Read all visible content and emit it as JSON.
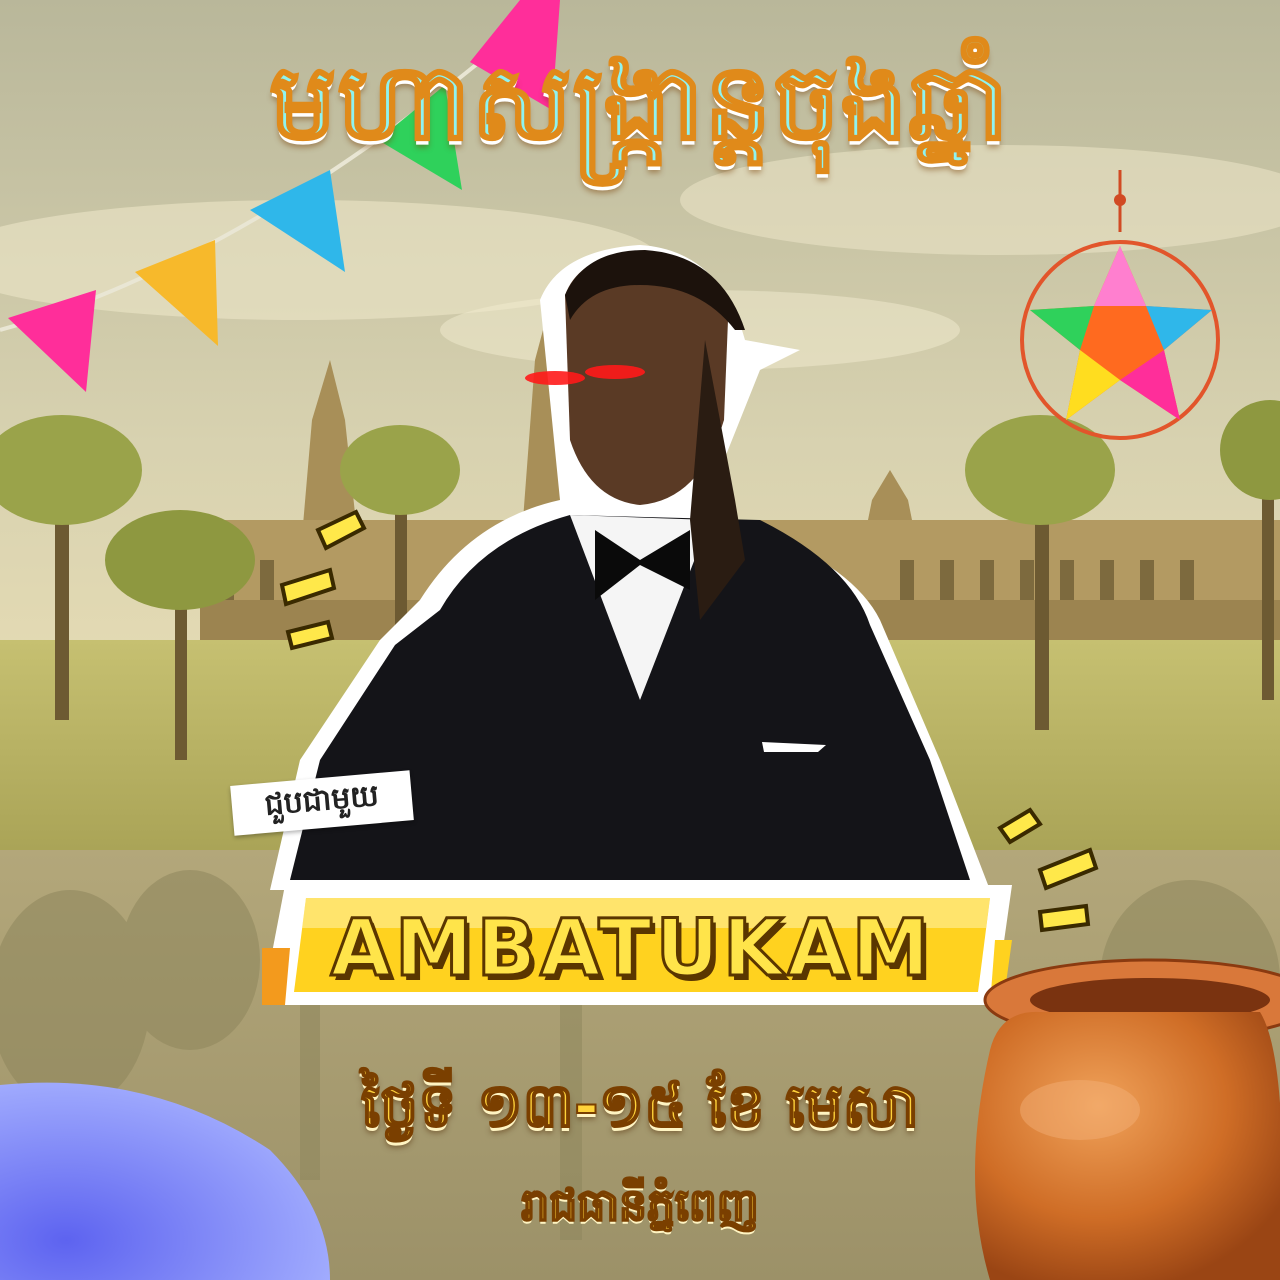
{
  "poster": {
    "title": "មហាសង្រ្កាន្តចុងឆ្នាំ",
    "tagline": "ជួបជាមួយ",
    "performer_name": "AMBATUKAM",
    "date_line": "ថ្ងៃទី ១៣-១៥ ខែ មេសា",
    "venue": "រាជធានីភ្នំពេញ"
  },
  "colors": {
    "sky_top": "#c9c7a8",
    "grass": "#b9b764",
    "water": "#a89e72",
    "title_fill": "#8ff3ef",
    "title_outline": "#e08a1a",
    "banner_yellow": "#ffd21f",
    "accent_pink": "#ff2e9a",
    "accent_blue": "#2fb7ea",
    "accent_gold": "#f7b92b",
    "accent_green": "#2fd15b",
    "pot_clay": "#c8611f",
    "corner_violet": "#6b74f5"
  },
  "decorations": {
    "flag_bunting": "bunting-icon",
    "star_lantern": "star-lantern-icon",
    "clay_pot": "clay-pot-icon",
    "emphasis_marks": "burst-lines-icon",
    "temple": "angkor-temple-silhouette"
  }
}
